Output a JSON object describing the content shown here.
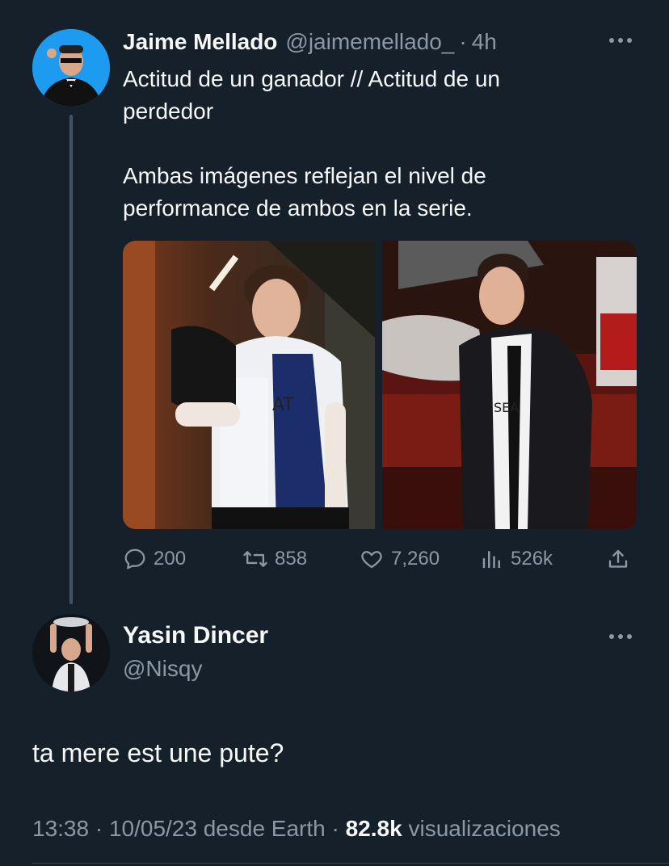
{
  "tweet": {
    "author_name": "Jaime Mellado",
    "author_handle": "@jaimemellado_",
    "separator": "·",
    "time": "4h",
    "text_line_1": "Actitud de un ganador // Actitud de un",
    "text_line_2": "perdedor",
    "text_line_3": "Ambas imágenes reflejan el nivel de",
    "text_line_4": "performance de ambos en la serie.",
    "media_jersey_left": "AT",
    "media_jersey_right": "SEA",
    "actions": {
      "replies": "200",
      "retweets": "858",
      "likes": "7,260",
      "views": "526k"
    }
  },
  "reply": {
    "author_name": "Yasin Dincer",
    "author_handle": "@Nisqy",
    "text": "ta mere est une pute?",
    "timestamp": "13:38 · 10/05/23 desde Earth",
    "separator": "·",
    "views_count": "82.8k",
    "views_label": "visualizaciones"
  },
  "icons": {
    "reply": "speech-bubble-icon",
    "retweet": "retweet-icon",
    "like": "heart-icon",
    "views": "bar-chart-icon",
    "share": "share-icon",
    "more": "more-dots-icon"
  },
  "colors": {
    "background": "#15202b",
    "text_primary": "#f7f9f9",
    "text_secondary": "#8b98a5",
    "thread_line": "#425364"
  }
}
